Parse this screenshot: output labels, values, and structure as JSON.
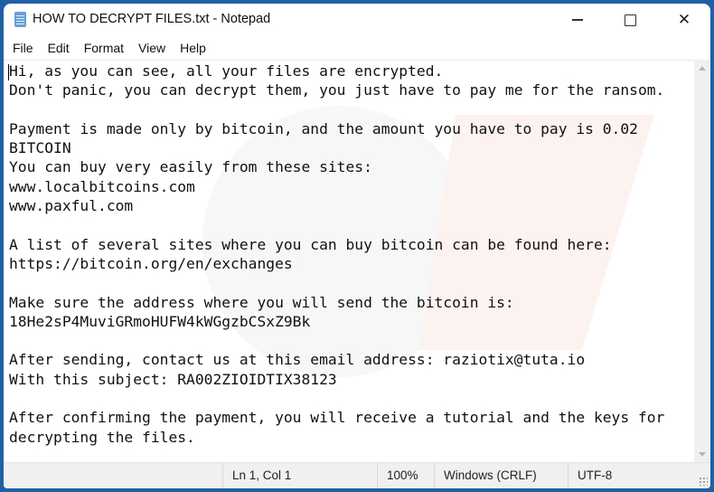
{
  "window": {
    "title": "HOW TO DECRYPT FILES.txt - Notepad",
    "app_icon": "notepad-icon",
    "controls": {
      "minimize": "minimize-icon",
      "maximize": "maximize-icon",
      "close": "close-icon",
      "close_glyph": "✕"
    }
  },
  "menu": {
    "items": [
      {
        "label": "File"
      },
      {
        "label": "Edit"
      },
      {
        "label": "Format"
      },
      {
        "label": "View"
      },
      {
        "label": "Help"
      }
    ]
  },
  "editor": {
    "content": "Hi, as you can see, all your files are encrypted.\nDon't panic, you can decrypt them, you just have to pay me for the ransom.\n\nPayment is made only by bitcoin, and the amount you have to pay is 0.02\nBITCOIN\nYou can buy very easily from these sites:\nwww.localbitcoins.com\nwww.paxful.com\n\nA list of several sites where you can buy bitcoin can be found here:\nhttps://bitcoin.org/en/exchanges\n\nMake sure the address where you will send the bitcoin is:\n18He2sP4MuviGRmoHUFW4kWGgzbCSxZ9Bk\n\nAfter sending, contact us at this email address: raziotix@tuta.io\nWith this subject: RA002ZIOIDTIX38123\n\nAfter confirming the payment, you will receive a tutorial and the keys for\ndecrypting the files."
  },
  "statusbar": {
    "position": "Ln 1, Col 1",
    "zoom": "100%",
    "line_ending": "Windows (CRLF)",
    "encoding": "UTF-8"
  },
  "colors": {
    "desktop_background": "#1f5fa3",
    "window_background": "#ffffff",
    "statusbar_background": "#f0f0f0"
  }
}
